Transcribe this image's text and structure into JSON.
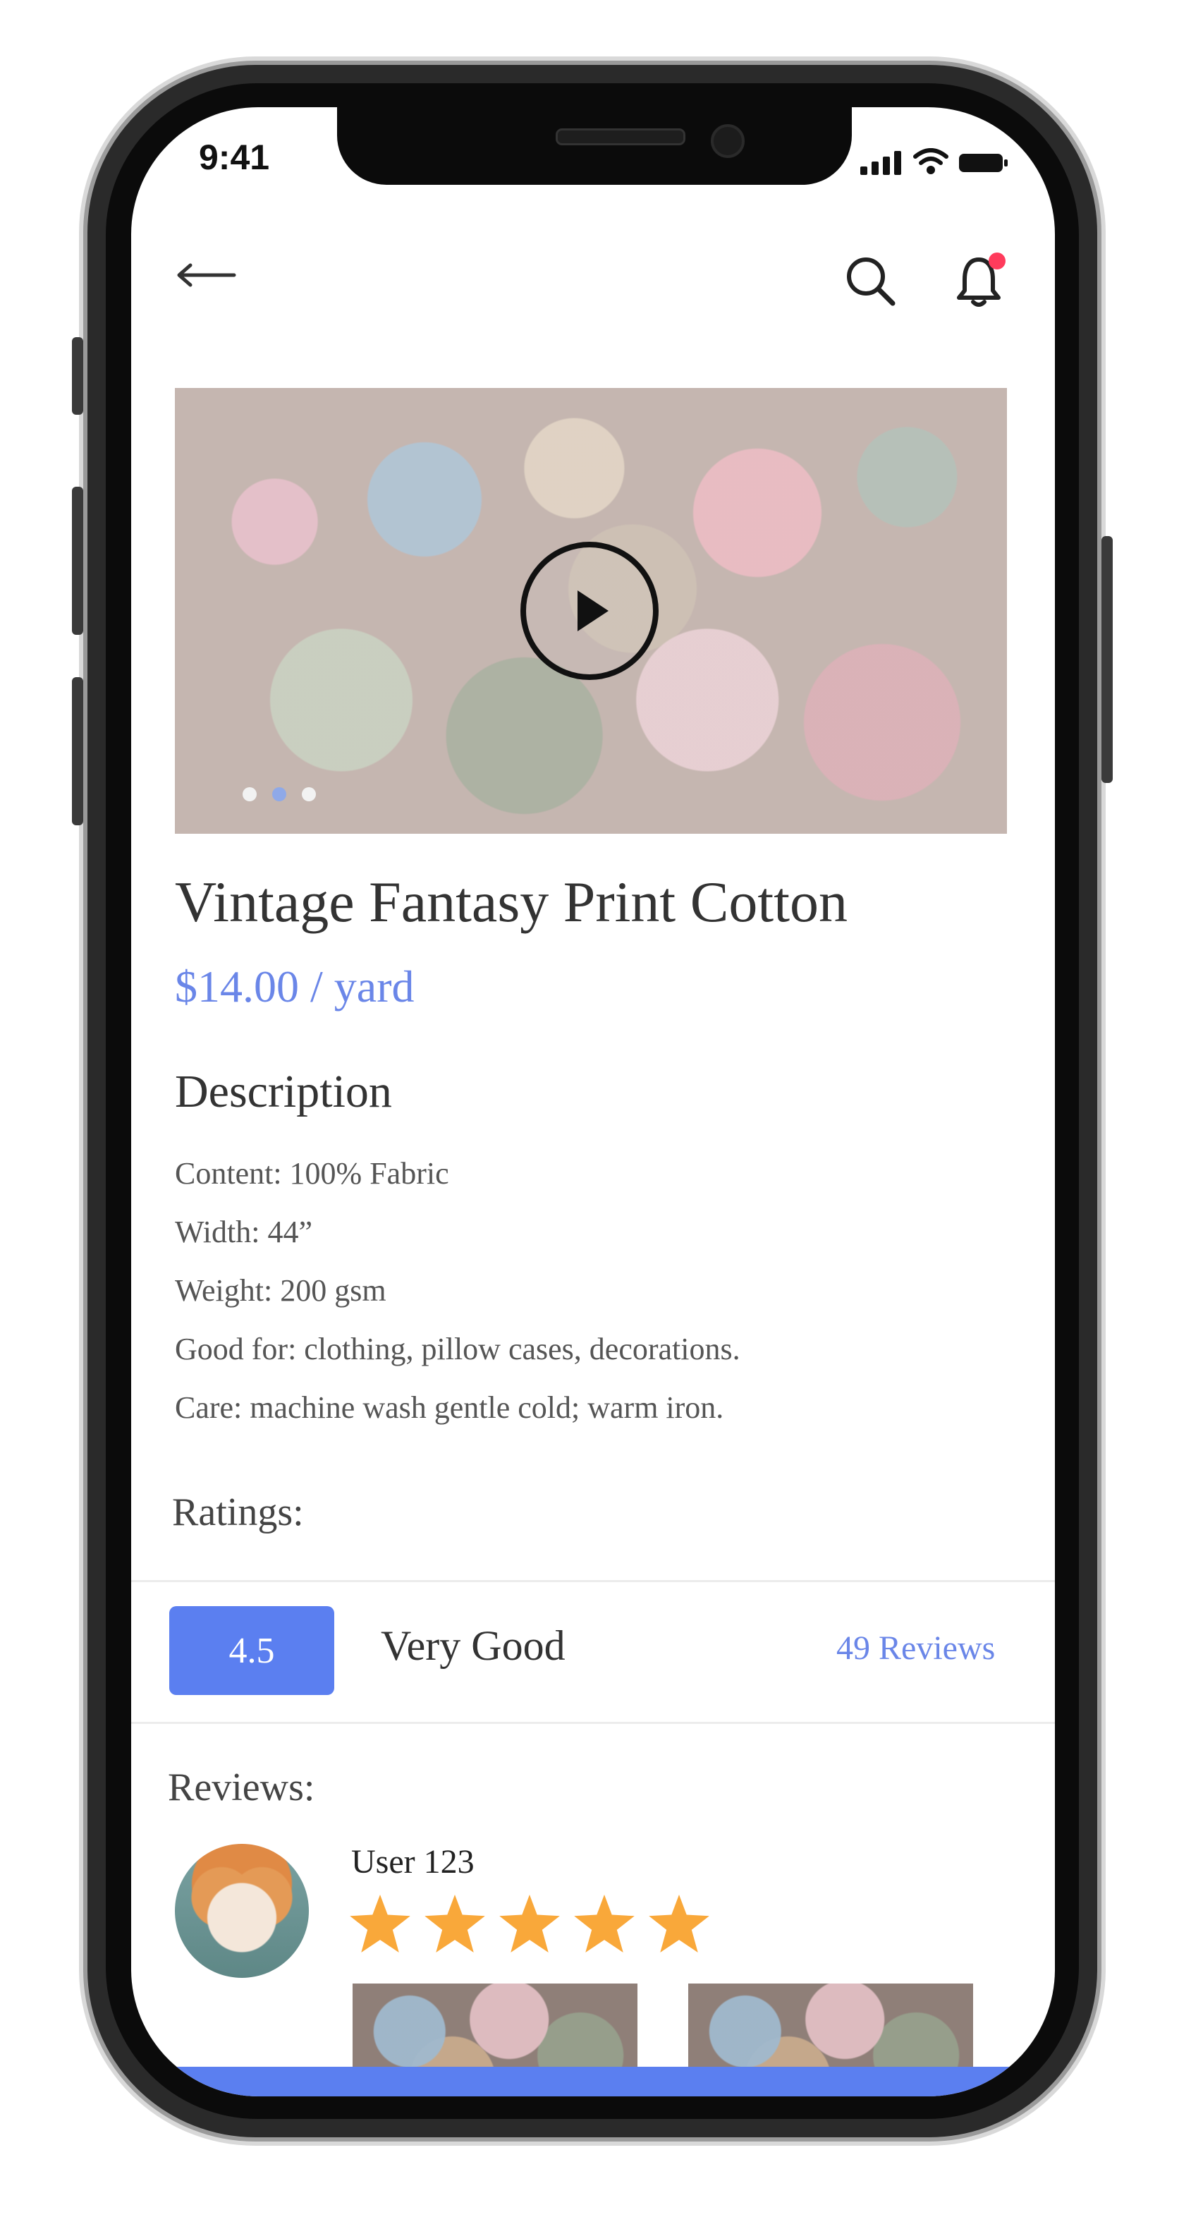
{
  "status_bar": {
    "time": "9:41"
  },
  "header": {
    "back_icon": "back-arrow-icon",
    "search_icon": "search-icon",
    "notification_icon": "bell-icon",
    "notification_dot_color": "#ff3b5c"
  },
  "product": {
    "title": "Vintage Fantasy Print Cotton",
    "price": "$14.00 / yard",
    "media": {
      "type": "video",
      "slides": 3,
      "active_slide": 2
    }
  },
  "description": {
    "heading": "Description",
    "lines": [
      "Content: 100% Fabric",
      "Width: 44”",
      "Weight: 200 gsm",
      "Good for: clothing, pillow cases, decorations.",
      "Care: machine wash gentle cold; warm iron."
    ]
  },
  "ratings": {
    "label": "Ratings:",
    "score": "4.5",
    "verdict": "Very Good",
    "reviews_link": "49 Reviews"
  },
  "reviews": {
    "label": "Reviews:",
    "items": [
      {
        "user": "User 123",
        "stars": 5
      }
    ]
  },
  "colors": {
    "accent": "#5b7ff0",
    "link": "#6a86e8",
    "star": "#f9a83a"
  }
}
